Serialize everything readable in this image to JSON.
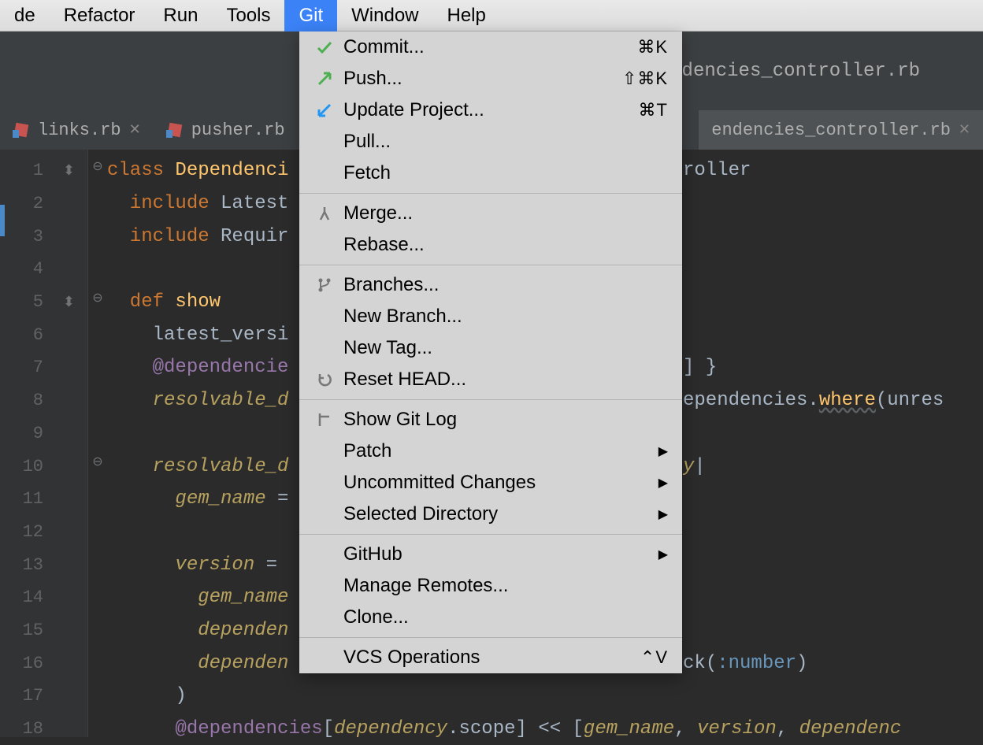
{
  "menubar": {
    "items": [
      {
        "label": "de"
      },
      {
        "label": "Refactor"
      },
      {
        "label": "Run"
      },
      {
        "label": "Tools"
      },
      {
        "label": "Git"
      },
      {
        "label": "Window"
      },
      {
        "label": "Help"
      }
    ],
    "active_index": 4
  },
  "breadcrumb": {
    "text": "ndencies_controller.rb"
  },
  "tabs": {
    "left": [
      {
        "name": "links.rb"
      },
      {
        "name": "pusher.rb"
      }
    ],
    "right": {
      "name": "endencies_controller.rb"
    }
  },
  "dropdown": {
    "groups": [
      [
        {
          "icon": "check",
          "label": "Commit...",
          "shortcut": "⌘K"
        },
        {
          "icon": "push",
          "label": "Push...",
          "shortcut": "⇧⌘K"
        },
        {
          "icon": "update",
          "label": "Update Project...",
          "shortcut": "⌘T"
        },
        {
          "label": "Pull..."
        },
        {
          "label": "Fetch"
        }
      ],
      [
        {
          "icon": "merge",
          "label": "Merge..."
        },
        {
          "label": "Rebase..."
        }
      ],
      [
        {
          "icon": "branch",
          "label": "Branches..."
        },
        {
          "label": "New Branch..."
        },
        {
          "label": "New Tag..."
        },
        {
          "icon": "reset",
          "label": "Reset HEAD..."
        }
      ],
      [
        {
          "icon": "log",
          "label": "Show Git Log"
        },
        {
          "label": "Patch",
          "submenu": true
        },
        {
          "label": "Uncommitted Changes",
          "submenu": true
        },
        {
          "label": "Selected Directory",
          "submenu": true
        }
      ],
      [
        {
          "label": "GitHub",
          "submenu": true
        },
        {
          "label": "Manage Remotes..."
        },
        {
          "label": "Clone..."
        }
      ],
      [
        {
          "label": "VCS Operations",
          "shortcut": "⌃V"
        }
      ]
    ]
  },
  "gutter": {
    "lines": [
      "1",
      "2",
      "3",
      "4",
      "5",
      "6",
      "7",
      "8",
      "9",
      "10",
      "11",
      "12",
      "13",
      "14",
      "15",
      "16",
      "17",
      "18"
    ],
    "annotations": {
      "1": "⬍",
      "5": "⬍"
    }
  },
  "code": {
    "lines": [
      [
        {
          "t": "class ",
          "c": "kw"
        },
        {
          "t": "Dependenci",
          "c": "cls"
        }
      ],
      [
        {
          "t": "  include ",
          "c": "kw"
        },
        {
          "t": "Latest",
          "c": "id"
        }
      ],
      [
        {
          "t": "  include ",
          "c": "kw"
        },
        {
          "t": "Requir",
          "c": "id"
        }
      ],
      [
        {
          "t": "",
          "c": "id"
        }
      ],
      [
        {
          "t": "  def ",
          "c": "kw"
        },
        {
          "t": "show",
          "c": "cls"
        }
      ],
      [
        {
          "t": "    latest_versi",
          "c": "id"
        }
      ],
      [
        {
          "t": "    ",
          "c": "id"
        },
        {
          "t": "@dependencie",
          "c": "ivar"
        }
      ],
      [
        {
          "t": "    ",
          "c": "id"
        },
        {
          "t": "resolvable_d",
          "c": "param"
        }
      ],
      [
        {
          "t": "",
          "c": "id"
        }
      ],
      [
        {
          "t": "    ",
          "c": "id"
        },
        {
          "t": "resolvable_d",
          "c": "param"
        }
      ],
      [
        {
          "t": "      ",
          "c": "id"
        },
        {
          "t": "gem_name",
          "c": "param"
        },
        {
          "t": " =",
          "c": "id"
        }
      ],
      [
        {
          "t": "",
          "c": "id"
        }
      ],
      [
        {
          "t": "      ",
          "c": "id"
        },
        {
          "t": "version",
          "c": "param"
        },
        {
          "t": " = ",
          "c": "id"
        }
      ],
      [
        {
          "t": "        ",
          "c": "id"
        },
        {
          "t": "gem_name",
          "c": "param"
        }
      ],
      [
        {
          "t": "        ",
          "c": "id"
        },
        {
          "t": "dependen",
          "c": "param"
        }
      ],
      [
        {
          "t": "        ",
          "c": "id"
        },
        {
          "t": "dependen",
          "c": "param"
        }
      ],
      [
        {
          "t": "      )",
          "c": "id"
        }
      ],
      [
        {
          "t": "      ",
          "c": "id"
        },
        {
          "t": "@dependencies",
          "c": "ivar"
        },
        {
          "t": "[",
          "c": "id"
        },
        {
          "t": "dependency",
          "c": "param"
        },
        {
          "t": ".scope] << [",
          "c": "id"
        },
        {
          "t": "gem_name",
          "c": "param"
        },
        {
          "t": ", ",
          "c": "id"
        },
        {
          "t": "version",
          "c": "param"
        },
        {
          "t": ", ",
          "c": "id"
        },
        {
          "t": "dependenc",
          "c": "param"
        }
      ]
    ],
    "right_frags": {
      "r1": "roller",
      "r7": "] }",
      "r8a": "ependencies.",
      "r8b": "where",
      "r8c": "(unres",
      "r10": "y",
      "r10b": "|",
      "r16a": "ck",
      "r16b": "(",
      "r16c": ":number",
      "r16d": ")"
    }
  }
}
